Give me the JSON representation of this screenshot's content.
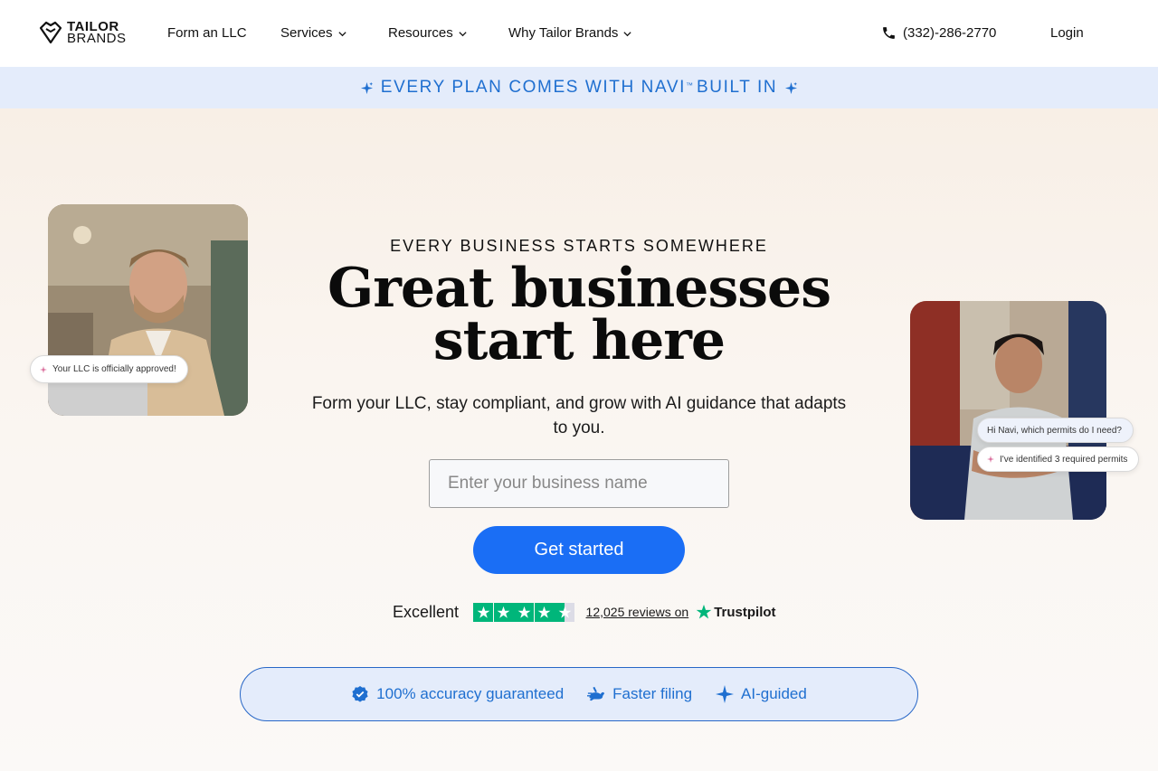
{
  "brand": {
    "line1": "TAILOR",
    "line2": "BRANDS"
  },
  "nav": {
    "items": [
      {
        "label": "Form an LLC",
        "dropdown": false
      },
      {
        "label": "Services",
        "dropdown": true
      },
      {
        "label": "Resources",
        "dropdown": true
      },
      {
        "label": "Why Tailor Brands",
        "dropdown": true
      }
    ],
    "phone": "(332)-286-2770",
    "login": "Login"
  },
  "banner": {
    "text_before": "EVERY PLAN COMES WITH NAVI",
    "tm": "™",
    "text_after": "BUILT IN",
    "icon": "sparkle-icon"
  },
  "hero": {
    "kicker": "EVERY BUSINESS STARTS SOMEWHERE",
    "headline_line1": "Great businesses",
    "headline_line2": "start here",
    "subtitle": "Form your LLC, stay compliant, and grow with AI guidance that adapts to you.",
    "input_placeholder": "Enter your business name",
    "cta": "Get started"
  },
  "photo_pills": {
    "left": "Your LLC is officially approved!",
    "right_question": "Hi Navi, which permits do I need?",
    "right_answer": "I've identified 3 required permits"
  },
  "trustpilot": {
    "rating_word": "Excellent",
    "stars": 4.5,
    "reviews": "12,025 reviews on",
    "brand": "Trustpilot"
  },
  "features": [
    {
      "label": "100% accuracy guaranteed",
      "icon": "verified-check-icon"
    },
    {
      "label": "Faster filing",
      "icon": "rabbit-icon"
    },
    {
      "label": "AI-guided",
      "icon": "sparkle-icon"
    }
  ],
  "colors": {
    "accent": "#1a6ef5",
    "banner_bg": "#e4ecfb",
    "banner_text": "#1f6fd0",
    "trustpilot_green": "#00b67a"
  }
}
